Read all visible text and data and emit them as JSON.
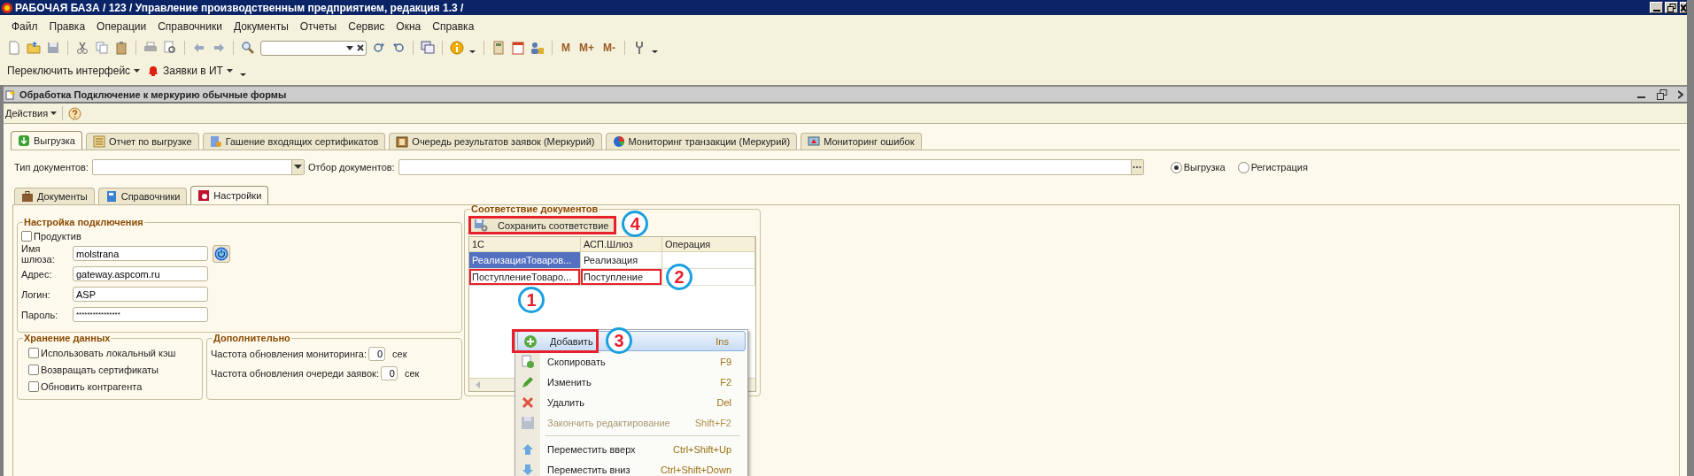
{
  "window": {
    "title": "РАБОЧАЯ БАЗА / 123 /  Управление производственным предприятием, редакция 1.3 /"
  },
  "menu": [
    "Файл",
    "Правка",
    "Операции",
    "Справочники",
    "Документы",
    "Отчеты",
    "Сервис",
    "Окна",
    "Справка"
  ],
  "toolbar": {
    "memory_buttons": [
      "M",
      "M+",
      "M-"
    ]
  },
  "toolbar2": [
    {
      "label": "Переключить интерфейс",
      "kind": "plain"
    },
    {
      "label": "Заявки в ИТ",
      "kind": "alarm"
    }
  ],
  "document": {
    "title": "Обработка  Подключение к меркурию обычные формы",
    "actions": "Действия"
  },
  "tabs": [
    {
      "label": "Выгрузка",
      "selected": true
    },
    {
      "label": "Отчет по выгрузке",
      "selected": false
    },
    {
      "label": "Гашение входящих сертификатов",
      "selected": false
    },
    {
      "label": "Очередь результатов заявок (Меркурий)",
      "selected": false
    },
    {
      "label": "Мониторинг транзакции (Меркурий)",
      "selected": false
    },
    {
      "label": "Мониторинг ошибок",
      "selected": false
    }
  ],
  "filters": {
    "doc_type_label": "Тип документов:",
    "doc_filter_label": "Отбор документов:"
  },
  "mode_options": [
    {
      "label": "Выгрузка",
      "selected": true
    },
    {
      "label": "Регистрация",
      "selected": false
    }
  ],
  "subtabs": [
    {
      "label": "Документы",
      "selected": false
    },
    {
      "label": "Справочники",
      "selected": false
    },
    {
      "label": "Настройки",
      "selected": true
    }
  ],
  "connection": {
    "title": "Настройка подключения",
    "productive": {
      "label": "Продуктив",
      "checked": false
    },
    "fields": [
      {
        "label": "Имя шлюза:",
        "value": "molstrana"
      },
      {
        "label": "Адрес:",
        "value": "gateway.aspcom.ru"
      },
      {
        "label": "Логин:",
        "value": "ASP"
      },
      {
        "label": "Пароль:",
        "value": "****************"
      }
    ]
  },
  "storage": {
    "title": "Хранение данных",
    "options": [
      {
        "label": "Использовать локальный кэш",
        "checked": false
      },
      {
        "label": "Возвращать сертификаты",
        "checked": false
      },
      {
        "label": "Обновить контрагента",
        "checked": false
      }
    ]
  },
  "extra": {
    "title": "Дополнительно",
    "fields": [
      {
        "label": "Частота обновления мониторинга:",
        "value": "0",
        "unit": "сек"
      },
      {
        "label": "Частота обновления очереди заявок:",
        "value": "0",
        "unit": "сек"
      }
    ]
  },
  "mapping": {
    "title": "Соответствие документов",
    "save_button": {
      "label": "Сохранить соответствие",
      "highlighted": true,
      "callout": "4"
    },
    "columns": [
      "1С",
      "АСП.Шлюз",
      "Операция"
    ],
    "rows": [
      {
        "selected": true,
        "column_1": {
          "text": "РеализацияТоваров...",
          "highlighted": false
        },
        "column_2": {
          "text": "Реализация",
          "highlighted": false
        }
      },
      {
        "selected": false,
        "column_1": {
          "text": "ПоступлениеТоваро...",
          "highlighted": true,
          "callout": "1"
        },
        "column_2": {
          "text": "Поступление",
          "highlighted": true,
          "callout": "2"
        }
      }
    ]
  },
  "context_menu": [
    {
      "kind": "item",
      "label": "Добавить",
      "shortcut": "Ins",
      "selected": true,
      "disabled": false,
      "highlighted": true,
      "callout": "3"
    },
    {
      "kind": "item",
      "label": "Скопировать",
      "shortcut": "F9",
      "selected": false,
      "disabled": false,
      "highlighted": false
    },
    {
      "kind": "item",
      "label": "Изменить",
      "shortcut": "F2",
      "selected": false,
      "disabled": false,
      "highlighted": false
    },
    {
      "kind": "item",
      "label": "Удалить",
      "shortcut": "Del",
      "selected": false,
      "disabled": false,
      "highlighted": false
    },
    {
      "kind": "item",
      "label": "Закончить редактирование",
      "shortcut": "Shift+F2",
      "selected": false,
      "disabled": true,
      "highlighted": false
    },
    {
      "kind": "separator"
    },
    {
      "kind": "item",
      "label": "Переместить вверх",
      "shortcut": "Ctrl+Shift+Up",
      "selected": false,
      "disabled": false,
      "highlighted": false
    },
    {
      "kind": "item",
      "label": "Переместить вниз",
      "shortcut": "Ctrl+Shift+Down",
      "selected": false,
      "disabled": false,
      "highlighted": false
    }
  ]
}
